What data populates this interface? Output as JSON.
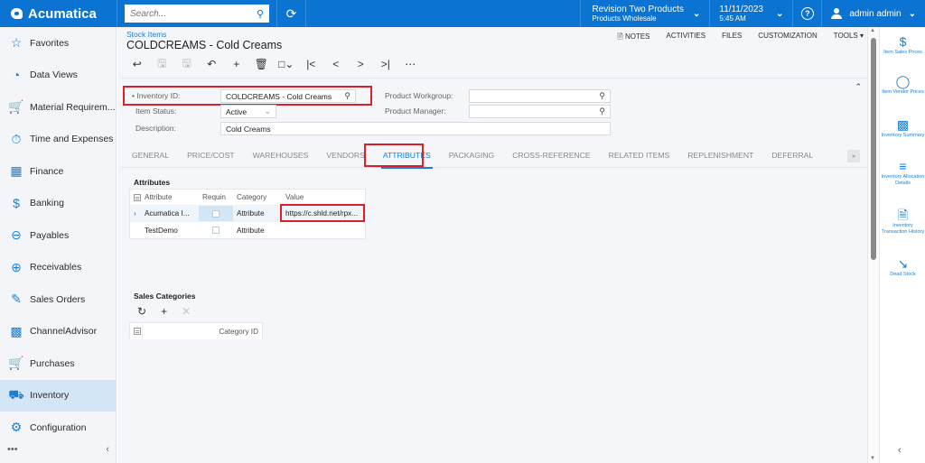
{
  "header": {
    "logo": "Acumatica",
    "search_placeholder": "Search...",
    "tenant_name": "Revision Two Products",
    "tenant_branch": "Products Wholesale",
    "date": "11/11/2023",
    "time": "5:45 AM",
    "user": "admin admin",
    "brand_color": "#0b73d2"
  },
  "sidebar": {
    "items": [
      {
        "label": "Favorites",
        "icon": "star-icon"
      },
      {
        "label": "Data Views",
        "icon": "pie-chart-icon"
      },
      {
        "label": "Material Requirem...",
        "icon": "cart-plus-icon"
      },
      {
        "label": "Time and Expenses",
        "icon": "stopwatch-icon"
      },
      {
        "label": "Finance",
        "icon": "calculator-icon"
      },
      {
        "label": "Banking",
        "icon": "dollar-icon"
      },
      {
        "label": "Payables",
        "icon": "minus-circle-icon"
      },
      {
        "label": "Receivables",
        "icon": "plus-circle-icon"
      },
      {
        "label": "Sales Orders",
        "icon": "pencil-square-icon"
      },
      {
        "label": "ChannelAdvisor",
        "icon": "building-icon"
      },
      {
        "label": "Purchases",
        "icon": "cart-icon"
      },
      {
        "label": "Inventory",
        "icon": "truck-icon",
        "active": true
      },
      {
        "label": "Configuration",
        "icon": "gear-icon"
      }
    ],
    "more": "•••",
    "collapse": "‹"
  },
  "page": {
    "breadcrumb": "Stock Items",
    "title": "COLDCREAMS - Cold Creams",
    "actions": [
      "NOTES",
      "ACTIVITIES",
      "FILES",
      "CUSTOMIZATION",
      "TOOLS ▾"
    ]
  },
  "form": {
    "inventory_id_label": "Inventory ID:",
    "inventory_id_value": "COLDCREAMS - Cold Creams",
    "item_status_label": "Item Status:",
    "item_status_value": "Active",
    "description_label": "Description:",
    "description_value": "Cold Creams",
    "product_workgroup_label": "Product Workgroup:",
    "product_workgroup_value": "",
    "product_manager_label": "Product Manager:",
    "product_manager_value": ""
  },
  "tabs": [
    "GENERAL",
    "PRICE/COST",
    "WAREHOUSES",
    "VENDORS",
    "ATTRIBUTES",
    "PACKAGING",
    "CROSS-REFERENCE",
    "RELATED ITEMS",
    "REPLENISHMENT",
    "DEFERRAL"
  ],
  "active_tab": "ATTRIBUTES",
  "attributes": {
    "title": "Attributes",
    "columns": [
      "Attribute",
      "Requin",
      "Category",
      "Value"
    ],
    "rows": [
      {
        "attribute": "Acumatica I...",
        "required": false,
        "category": "Attribute",
        "value": "https://c.shld.net/rpx..."
      },
      {
        "attribute": "TestDemo",
        "required": false,
        "category": "Attribute",
        "value": ""
      }
    ]
  },
  "sales_categories": {
    "title": "Sales Categories",
    "columns": [
      "Category ID"
    ]
  },
  "right_panel": {
    "items": [
      {
        "label": "Item Sales Prices",
        "icon": "dollar-icon"
      },
      {
        "label": "Item Vendor Prices",
        "icon": "tag-icon"
      },
      {
        "label": "Inventory Summary",
        "icon": "building-icon"
      },
      {
        "label": "Inventory Allocation Details",
        "icon": "list-dollar-icon"
      },
      {
        "label": "Inventory Transaction History",
        "icon": "document-download-icon"
      },
      {
        "label": "Dead Stock",
        "icon": "line-chart-icon"
      }
    ]
  }
}
